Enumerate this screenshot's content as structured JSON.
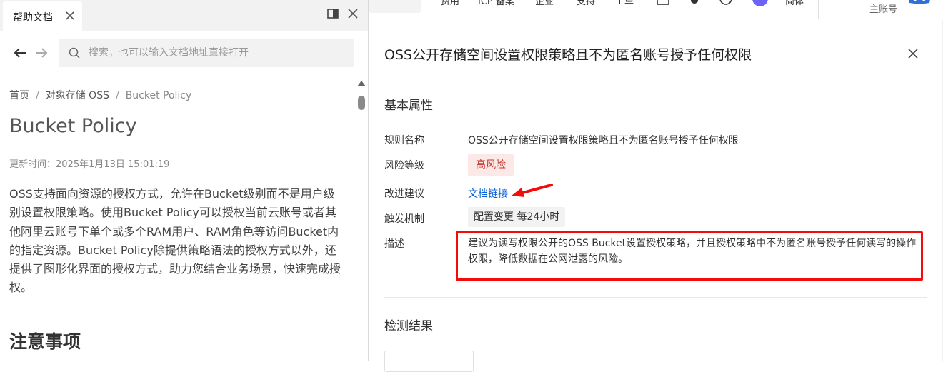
{
  "help_panel": {
    "tab_label": "帮助文档",
    "search": {
      "placeholder": "搜索，也可以输入文档地址直接打开"
    },
    "breadcrumb": [
      "首页",
      "对象存储 OSS",
      "Bucket Policy"
    ],
    "breadcrumb_sep": "/",
    "doc": {
      "title": "Bucket Policy",
      "updated": "更新时间：2025年1月13日 15:01:19",
      "paragraph": "OSS支持面向资源的授权方式，允许在Bucket级别而不是用户级别设置权限策略。使用Bucket Policy可以授权当前云账号或者其他阿里云账号下单个或多个RAM用户、RAM角色等访问Bucket内的指定资源。Bucket Policy除提供策略语法的授权方式以外，还提供了图形化界面的授权方式，助力您结合业务场景，快速完成授权。",
      "section_heading": "注意事项"
    }
  },
  "top_header": {
    "account_label": "主账号"
  },
  "drawer": {
    "title": "OSS公开存储空间设置权限策略且不为匿名账号授予任何权限",
    "section_basic": "基本属性",
    "properties": {
      "rule_name_label": "规则名称",
      "rule_name_value": "OSS公开存储空间设置权限策略且不为匿名账号授予任何权限",
      "risk_label": "风险等级",
      "risk_value": "高风险",
      "suggest_label": "改进建议",
      "suggest_link": "文档链接",
      "trigger_label": "触发机制",
      "trigger_value": "配置变更 每24小时",
      "desc_label": "描述",
      "desc_value": "建议为读写权限公开的OSS Bucket设置授权策略，并且授权策略中不为匿名账号授予任何读写的操作权限，降低数据在公网泄露的风险。"
    },
    "section_result": "检测结果"
  },
  "colors": {
    "risk_text": "#c0392b",
    "risk_bg": "#fde8e8",
    "link": "#0b62d6",
    "annotation": "#f20c0c"
  },
  "icons": [
    "close-icon",
    "split-view-icon",
    "arrow-left-icon",
    "arrow-right-icon",
    "search-icon",
    "annotation-arrow-icon"
  ]
}
